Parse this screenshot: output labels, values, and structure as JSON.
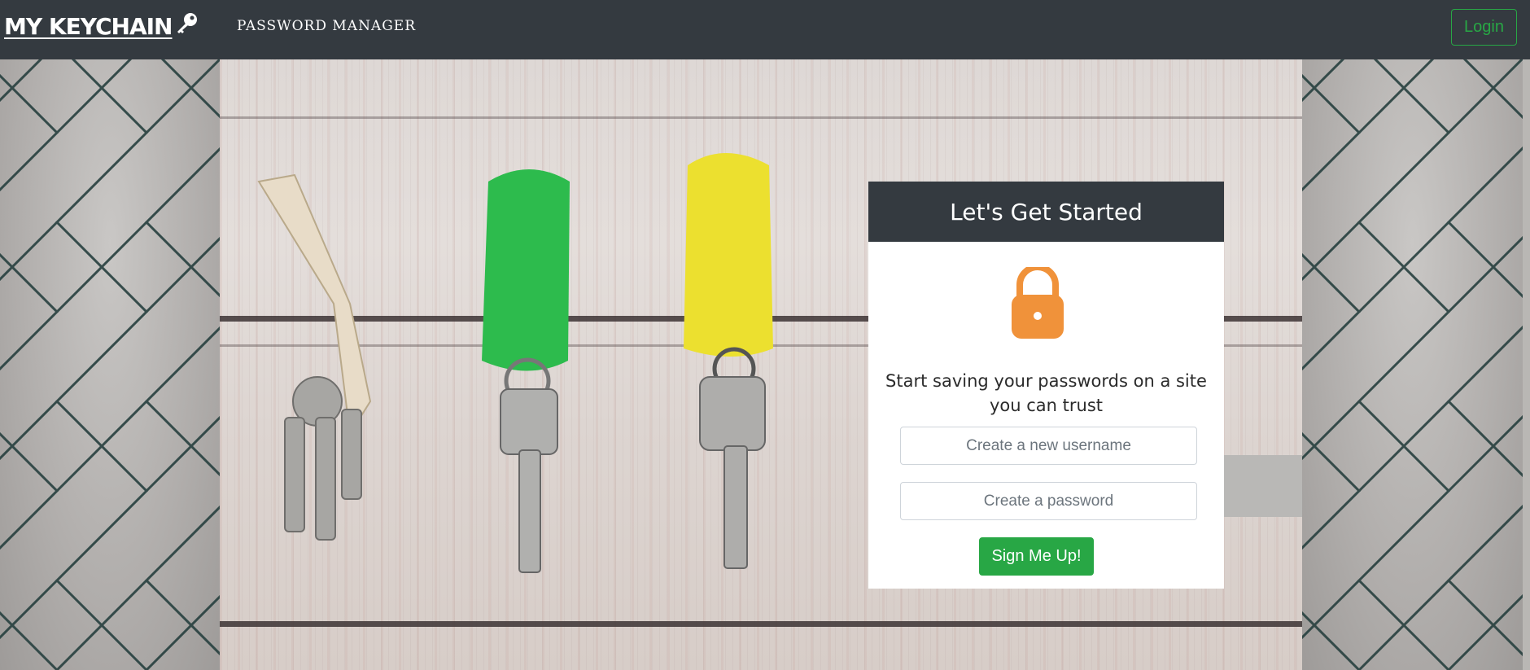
{
  "nav": {
    "brand": "MY KEYCHAIN",
    "brand_icon": "key-icon",
    "subtitle": "PASSWORD MANAGER",
    "login_label": "Login"
  },
  "signup": {
    "title": "Let's Get Started",
    "icon": "lock-icon",
    "tagline": "Start saving your passwords on a site you can trust",
    "username_placeholder": "Create a new username",
    "username_value": "",
    "password_placeholder": "Create a password",
    "password_value": "",
    "submit_label": "Sign Me Up!"
  },
  "colors": {
    "navbar": "#343a40",
    "success": "#28a745",
    "lock": "#f0923a"
  }
}
